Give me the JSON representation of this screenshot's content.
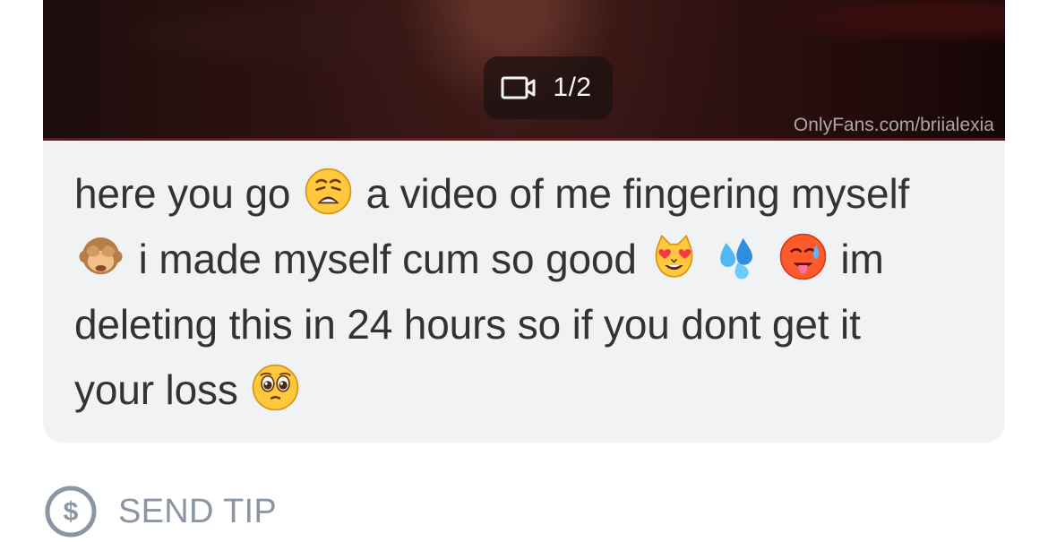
{
  "message": {
    "media": {
      "count": "1/2",
      "watermark": "OnlyFans.com/briialexia",
      "icon": "video-camera-icon"
    },
    "text_segments": [
      "here you go",
      "a video of me fingering myself",
      "i made myself cum so good",
      "im",
      "deleting this in 24 hours so if you dont get it",
      "your loss"
    ],
    "emojis": [
      "weary-face-icon",
      "see-no-evil-monkey-icon",
      "heart-eyes-cat-icon",
      "sweat-droplets-icon",
      "hot-face-icon",
      "pleading-face-icon"
    ]
  },
  "actions": {
    "send_tip": {
      "label": "SEND TIP",
      "icon": "dollar-circle-icon"
    }
  },
  "colors": {
    "message_background": "#f1f2f4",
    "message_text": "#333333",
    "tip_gray": "#8a96a3"
  }
}
